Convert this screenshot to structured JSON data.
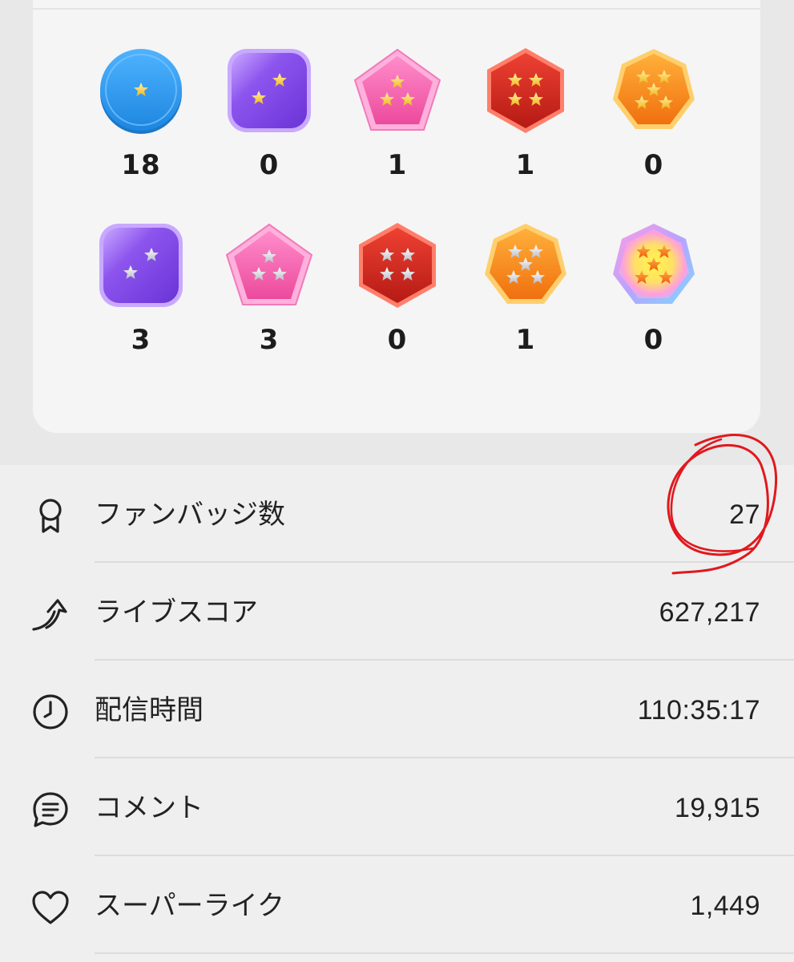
{
  "badges": {
    "row1": [
      {
        "name": "blue-coin-1-star",
        "count": "18"
      },
      {
        "name": "purple-square-2-star",
        "count": "0"
      },
      {
        "name": "pink-pentagon-3-star",
        "count": "1"
      },
      {
        "name": "red-hexagon-4-star",
        "count": "1"
      },
      {
        "name": "orange-heptagon-5-star",
        "count": "0"
      }
    ],
    "row2": [
      {
        "name": "purple-square-2-silver-star",
        "count": "3"
      },
      {
        "name": "pink-pentagon-3-silver-star",
        "count": "3"
      },
      {
        "name": "red-hexagon-4-silver-star",
        "count": "0"
      },
      {
        "name": "orange-heptagon-5-silver-star",
        "count": "1"
      },
      {
        "name": "rainbow-heptagon-5-star",
        "count": "0"
      }
    ]
  },
  "stats": [
    {
      "icon": "ribbon-badge-icon",
      "label": "ファンバッジ数",
      "value": "27"
    },
    {
      "icon": "rising-arrow-icon",
      "label": "ライブスコア",
      "value": "627,217"
    },
    {
      "icon": "clock-icon",
      "label": "配信時間",
      "value": "110:35:17"
    },
    {
      "icon": "comment-icon",
      "label": "コメント",
      "value": "19,915"
    },
    {
      "icon": "heart-icon",
      "label": "スーパーライク",
      "value": "1,449"
    }
  ],
  "colors": {
    "annotation": "#e0191e",
    "blue_badge": "#2f9cef",
    "purple_badge": "#8a4fe8",
    "pink_badge": "#f05aa8",
    "red_badge": "#d42a22",
    "orange_badge": "#f7941d"
  }
}
